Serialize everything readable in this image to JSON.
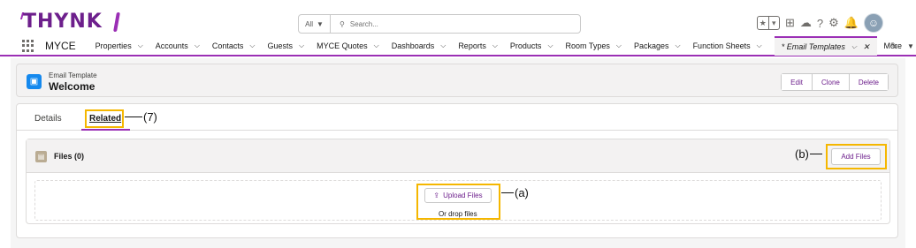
{
  "brand": {
    "logo_text": "THYNK",
    "accent_color": "#9b2fb5",
    "primary_text_color": "#6d1f8c"
  },
  "search": {
    "scope_label": "All",
    "placeholder": "Search..."
  },
  "top_icons": [
    "favorites-star-icon",
    "favorites-dropdown-icon",
    "add-icon",
    "trailhead-icon",
    "help-icon",
    "setup-gear-icon",
    "notifications-bell-icon",
    "user-avatar-icon"
  ],
  "nav": {
    "app_name": "MYCE",
    "items": [
      {
        "label": "Properties"
      },
      {
        "label": "Accounts"
      },
      {
        "label": "Contacts"
      },
      {
        "label": "Guests"
      },
      {
        "label": "MYCE Quotes"
      },
      {
        "label": "Dashboards"
      },
      {
        "label": "Reports"
      },
      {
        "label": "Products"
      },
      {
        "label": "Room Types"
      },
      {
        "label": "Packages"
      },
      {
        "label": "Function Sheets"
      }
    ],
    "active_tab": {
      "label": "* Email Templates"
    },
    "more_label": "More"
  },
  "record": {
    "object_label": "Email Template",
    "name": "Welcome",
    "actions": {
      "edit": "Edit",
      "clone": "Clone",
      "delete": "Delete"
    }
  },
  "tabs": {
    "details": "Details",
    "related": "Related"
  },
  "files": {
    "title": "Files (0)",
    "add_button": "Add Files",
    "upload_button": "Upload Files",
    "drop_text": "Or drop files"
  },
  "annotations": {
    "related": "(7)",
    "add_files": "(b)",
    "upload": "(a)",
    "highlight_color": "#f5b700"
  }
}
